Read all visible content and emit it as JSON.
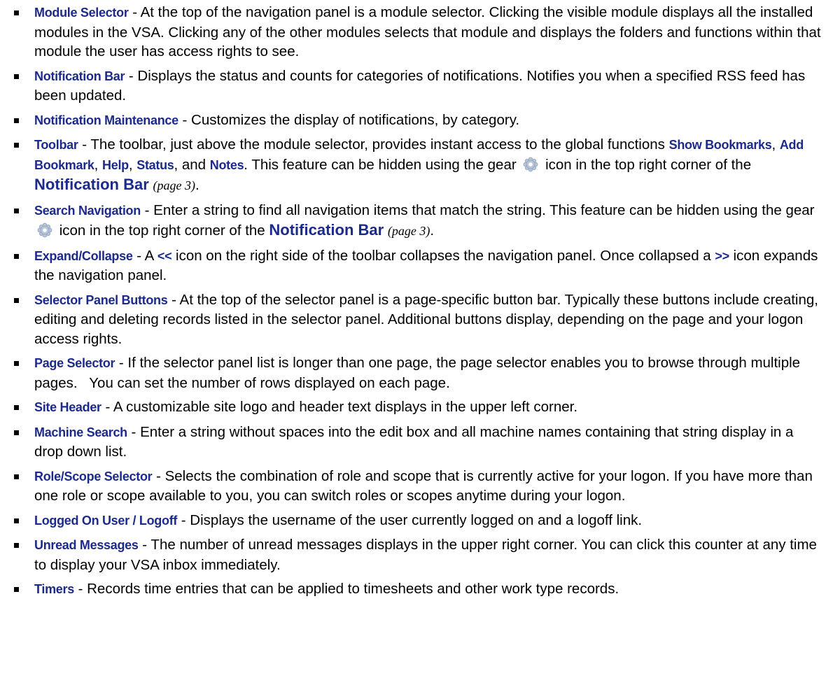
{
  "items": [
    {
      "term": "Module Selector",
      "text": " - At the top of the navigation panel is a module selector. Clicking the visible module displays all the installed modules in the VSA. Clicking any of the other modules selects that module and displays the folders and functions within that module the user has access rights to see."
    },
    {
      "term": "Notification Bar",
      "text": " - Displays the status and counts for categories of notifications. Notifies you when a specified RSS feed has been updated."
    },
    {
      "term": "Notification Maintenance",
      "text": " - Customizes the display of notifications, by category."
    },
    {
      "term": "Toolbar",
      "text_a": " - The toolbar, just above the module selector, provides instant access to the global functions ",
      "functions": [
        "Show Bookmarks",
        "Add Bookmark",
        "Help",
        "Status",
        "Notes"
      ],
      "sep": ", ",
      "and": ", and ",
      "text_b": ". This feature can be hidden using the gear ",
      "gear_icon": "gear-icon",
      "text_c": " icon in the top right corner of the ",
      "link": "Notification Bar",
      "pageref": "(page 3)",
      "end": "."
    },
    {
      "term": "Search Navigation",
      "text_a": " - Enter a string to find all navigation items that match the string. This feature can be hidden using the gear ",
      "gear_icon": "gear-icon",
      "text_c": " icon in the top right corner of the ",
      "link": "Notification Bar",
      "pageref": "(page 3)",
      "end": "."
    },
    {
      "term": "Expand/Collapse",
      "text_a": " - A ",
      "collapse_symbol": "<<",
      "text_b": " icon on the right side of the toolbar collapses the navigation panel. Once collapsed a ",
      "expand_symbol": ">>",
      "text_c": " icon expands the navigation panel."
    },
    {
      "term": "Selector Panel Buttons",
      "text": " - At the top of the selector panel is a page-specific button bar. Typically these buttons include creating, editing and deleting records listed in the selector panel. Additional buttons display, depending on the page and your logon access rights."
    },
    {
      "term": "Page Selector",
      "text": " - If the selector panel list is longer than one page, the page selector enables you to browse through multiple pages.   You can set the number of rows displayed on each page."
    },
    {
      "term": "Site Header",
      "text": " - A customizable site logo and header text displays in the upper left corner."
    },
    {
      "term": "Machine Search",
      "text": " - Enter a string without spaces into the edit box and all machine names containing that string display in a drop down list."
    },
    {
      "term": "Role/Scope Selector",
      "text": " - Selects the combination of role and scope that is currently active for your logon. If you have more than one role or scope available to you, you can switch roles or scopes anytime during your logon."
    },
    {
      "term": "Logged On User / Logoff",
      "text": " - Displays the username of the user currently logged on and a logoff link."
    },
    {
      "term": "Unread Messages",
      "text": " - The number of unread messages displays in the upper right corner. You can click this counter at any time to display your VSA inbox immediately."
    },
    {
      "term": "Timers",
      "text": " - Records time entries that can be applied to timesheets and other work type records."
    }
  ]
}
